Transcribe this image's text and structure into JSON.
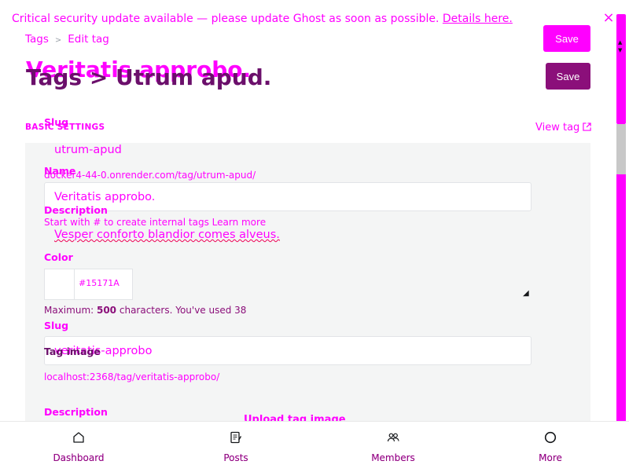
{
  "banner": {
    "message": "Critical security update available — please update Ghost as soon as possible.",
    "link": "Details here.",
    "close": "×"
  },
  "breadcrumb": {
    "root": "Tags",
    "separator": ">",
    "current": "Edit tag"
  },
  "titles": {
    "back": "Veritatis approbo.",
    "front": "Tags > Utrum apud."
  },
  "buttons": {
    "save_top": "Save",
    "save_main": "Save"
  },
  "section": {
    "basic_settings": "BASIC SETTINGS",
    "view_tag": "View tag"
  },
  "form": {
    "slug_label_1": "Slug",
    "slug_value_1": "utrum-apud",
    "url_1": "docker4-44-0.onrender.com/tag/utrum-apud/",
    "name_label": "Name",
    "name_value": "Veritatis approbo.",
    "description_label_1": "Description",
    "description_hint_1": "Start with # to create internal tags Learn more",
    "description_value": "Vesper conforto blandior comes alveus.",
    "color_label": "Color",
    "color_value": "#15171A",
    "char_count_prefix": "Maximum: ",
    "char_count_max": "500",
    "char_count_suffix": " characters. You've used 38",
    "slug_label_2": "Slug",
    "slug_value_2": "veritatis-approbo",
    "tag_image_label": "Tag image",
    "url_2": "localhost:2368/tag/veritatis-approbo/",
    "description_label_2": "Description",
    "upload_label": "Upload tag image"
  },
  "nav": [
    {
      "label": "Dashboard",
      "icon": "home-icon"
    },
    {
      "label": "Posts",
      "icon": "posts-icon"
    },
    {
      "label": "Members",
      "icon": "members-icon"
    },
    {
      "label": "More",
      "icon": "more-icon"
    }
  ],
  "colors": {
    "accent": "#ff00ff",
    "dark_accent": "#8b0f7a",
    "text": "#15171a"
  }
}
